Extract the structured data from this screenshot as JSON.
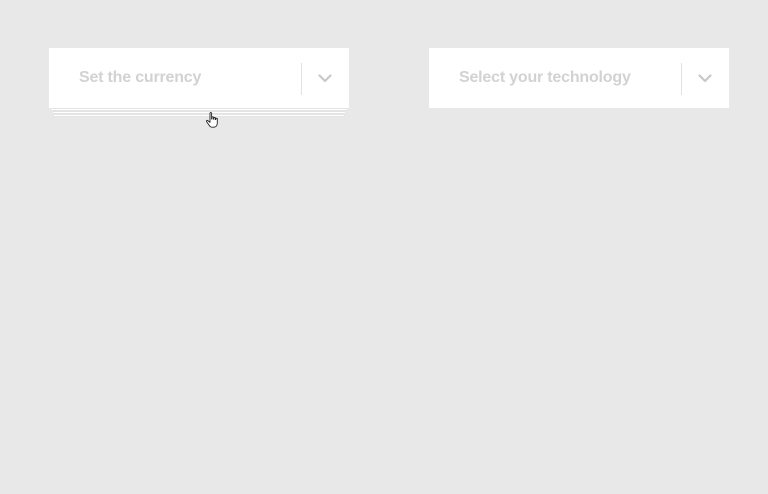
{
  "selects": {
    "currency": {
      "placeholder": "Set the currency",
      "icon": "chevron-down-icon"
    },
    "technology": {
      "placeholder": "Select your technology",
      "icon": "chevron-down-icon"
    }
  },
  "colors": {
    "background": "#e8e8e8",
    "field": "#ffffff",
    "placeholder_text": "#d2d2d2",
    "divider": "#e2e2e2",
    "chevron": "#c8c8c8"
  },
  "cursor": "hand-pointer-icon"
}
